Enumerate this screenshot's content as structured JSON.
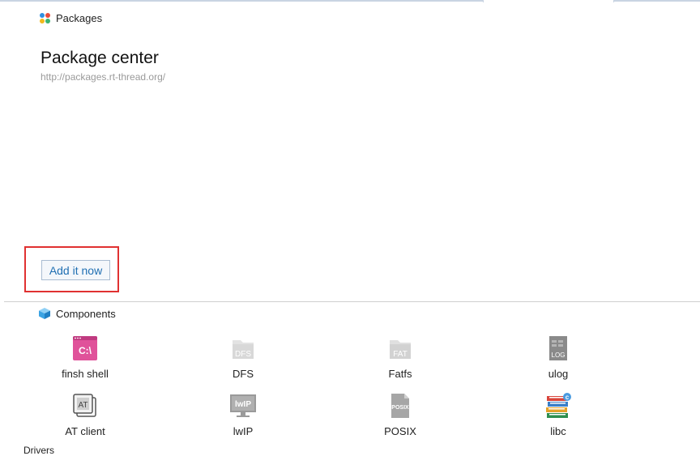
{
  "packages": {
    "header_label": "Packages",
    "title": "Package center",
    "url": "http://packages.rt-thread.org/",
    "add_button_label": "Add it now"
  },
  "components": {
    "header_label": "Components",
    "items": [
      {
        "label": "finsh shell",
        "icon": "finsh-shell-icon"
      },
      {
        "label": "DFS",
        "icon": "dfs-icon"
      },
      {
        "label": "Fatfs",
        "icon": "fatfs-icon"
      },
      {
        "label": "ulog",
        "icon": "ulog-icon"
      },
      {
        "label": "AT client",
        "icon": "at-client-icon"
      },
      {
        "label": "lwIP",
        "icon": "lwip-icon"
      },
      {
        "label": "POSIX",
        "icon": "posix-icon"
      },
      {
        "label": "libc",
        "icon": "libc-icon"
      }
    ],
    "icon_text": {
      "finsh": "C:\\",
      "dfs": "DFS",
      "fatfs": "FAT",
      "ulog": "LOG",
      "at": "AT",
      "lwip": "lwIP",
      "posix": "POSIX"
    }
  },
  "drivers": {
    "header_label": "Drivers"
  },
  "colors": {
    "highlight": "#e03131",
    "link": "#1f6fb2",
    "finsh": "#e0529a"
  }
}
